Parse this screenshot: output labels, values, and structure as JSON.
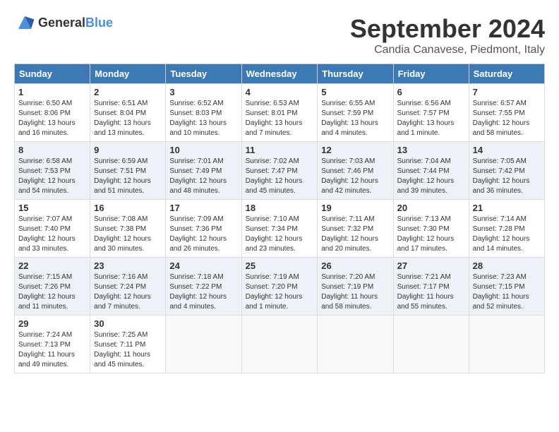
{
  "header": {
    "logo_general": "General",
    "logo_blue": "Blue",
    "month_title": "September 2024",
    "location": "Candia Canavese, Piedmont, Italy"
  },
  "weekdays": [
    "Sunday",
    "Monday",
    "Tuesday",
    "Wednesday",
    "Thursday",
    "Friday",
    "Saturday"
  ],
  "weeks": [
    [
      {
        "day": "1",
        "sunrise": "6:50 AM",
        "sunset": "8:06 PM",
        "daylight": "13 hours and 16 minutes."
      },
      {
        "day": "2",
        "sunrise": "6:51 AM",
        "sunset": "8:04 PM",
        "daylight": "13 hours and 13 minutes."
      },
      {
        "day": "3",
        "sunrise": "6:52 AM",
        "sunset": "8:03 PM",
        "daylight": "13 hours and 10 minutes."
      },
      {
        "day": "4",
        "sunrise": "6:53 AM",
        "sunset": "8:01 PM",
        "daylight": "13 hours and 7 minutes."
      },
      {
        "day": "5",
        "sunrise": "6:55 AM",
        "sunset": "7:59 PM",
        "daylight": "13 hours and 4 minutes."
      },
      {
        "day": "6",
        "sunrise": "6:56 AM",
        "sunset": "7:57 PM",
        "daylight": "13 hours and 1 minute."
      },
      {
        "day": "7",
        "sunrise": "6:57 AM",
        "sunset": "7:55 PM",
        "daylight": "12 hours and 58 minutes."
      }
    ],
    [
      {
        "day": "8",
        "sunrise": "6:58 AM",
        "sunset": "7:53 PM",
        "daylight": "12 hours and 54 minutes."
      },
      {
        "day": "9",
        "sunrise": "6:59 AM",
        "sunset": "7:51 PM",
        "daylight": "12 hours and 51 minutes."
      },
      {
        "day": "10",
        "sunrise": "7:01 AM",
        "sunset": "7:49 PM",
        "daylight": "12 hours and 48 minutes."
      },
      {
        "day": "11",
        "sunrise": "7:02 AM",
        "sunset": "7:47 PM",
        "daylight": "12 hours and 45 minutes."
      },
      {
        "day": "12",
        "sunrise": "7:03 AM",
        "sunset": "7:46 PM",
        "daylight": "12 hours and 42 minutes."
      },
      {
        "day": "13",
        "sunrise": "7:04 AM",
        "sunset": "7:44 PM",
        "daylight": "12 hours and 39 minutes."
      },
      {
        "day": "14",
        "sunrise": "7:05 AM",
        "sunset": "7:42 PM",
        "daylight": "12 hours and 36 minutes."
      }
    ],
    [
      {
        "day": "15",
        "sunrise": "7:07 AM",
        "sunset": "7:40 PM",
        "daylight": "12 hours and 33 minutes."
      },
      {
        "day": "16",
        "sunrise": "7:08 AM",
        "sunset": "7:38 PM",
        "daylight": "12 hours and 30 minutes."
      },
      {
        "day": "17",
        "sunrise": "7:09 AM",
        "sunset": "7:36 PM",
        "daylight": "12 hours and 26 minutes."
      },
      {
        "day": "18",
        "sunrise": "7:10 AM",
        "sunset": "7:34 PM",
        "daylight": "12 hours and 23 minutes."
      },
      {
        "day": "19",
        "sunrise": "7:11 AM",
        "sunset": "7:32 PM",
        "daylight": "12 hours and 20 minutes."
      },
      {
        "day": "20",
        "sunrise": "7:13 AM",
        "sunset": "7:30 PM",
        "daylight": "12 hours and 17 minutes."
      },
      {
        "day": "21",
        "sunrise": "7:14 AM",
        "sunset": "7:28 PM",
        "daylight": "12 hours and 14 minutes."
      }
    ],
    [
      {
        "day": "22",
        "sunrise": "7:15 AM",
        "sunset": "7:26 PM",
        "daylight": "12 hours and 11 minutes."
      },
      {
        "day": "23",
        "sunrise": "7:16 AM",
        "sunset": "7:24 PM",
        "daylight": "12 hours and 7 minutes."
      },
      {
        "day": "24",
        "sunrise": "7:18 AM",
        "sunset": "7:22 PM",
        "daylight": "12 hours and 4 minutes."
      },
      {
        "day": "25",
        "sunrise": "7:19 AM",
        "sunset": "7:20 PM",
        "daylight": "12 hours and 1 minute."
      },
      {
        "day": "26",
        "sunrise": "7:20 AM",
        "sunset": "7:19 PM",
        "daylight": "11 hours and 58 minutes."
      },
      {
        "day": "27",
        "sunrise": "7:21 AM",
        "sunset": "7:17 PM",
        "daylight": "11 hours and 55 minutes."
      },
      {
        "day": "28",
        "sunrise": "7:23 AM",
        "sunset": "7:15 PM",
        "daylight": "11 hours and 52 minutes."
      }
    ],
    [
      {
        "day": "29",
        "sunrise": "7:24 AM",
        "sunset": "7:13 PM",
        "daylight": "11 hours and 49 minutes."
      },
      {
        "day": "30",
        "sunrise": "7:25 AM",
        "sunset": "7:11 PM",
        "daylight": "11 hours and 45 minutes."
      },
      null,
      null,
      null,
      null,
      null
    ]
  ]
}
